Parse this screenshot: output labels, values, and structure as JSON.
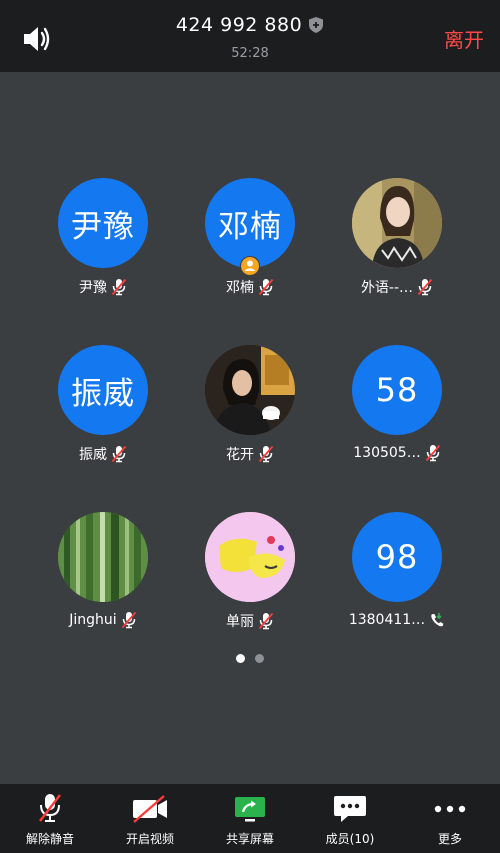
{
  "header": {
    "meeting_id": "424 992 880",
    "timer": "52:28",
    "leave_label": "离开"
  },
  "participants": [
    {
      "name": "尹豫",
      "avatar_text": "尹豫",
      "avatar_type": "text",
      "status": "muted"
    },
    {
      "name": "邓楠",
      "avatar_text": "邓楠",
      "avatar_type": "text",
      "status": "muted",
      "host": true
    },
    {
      "name": "外语--…",
      "avatar_type": "photo",
      "status": "muted"
    },
    {
      "name": "振威",
      "avatar_text": "振威",
      "avatar_type": "text",
      "status": "muted"
    },
    {
      "name": "花开",
      "avatar_type": "photo",
      "status": "muted"
    },
    {
      "name": "130505…",
      "avatar_text": "58",
      "avatar_type": "text",
      "status": "muted"
    },
    {
      "name": "Jinghui",
      "avatar_type": "photo",
      "status": "muted"
    },
    {
      "name": "单丽",
      "avatar_type": "photo",
      "status": "muted"
    },
    {
      "name": "1380411…",
      "avatar_text": "98",
      "avatar_type": "text",
      "status": "phone"
    }
  ],
  "pager": {
    "pages": 2,
    "current": 1
  },
  "toolbar": {
    "unmute_label": "解除静音",
    "video_label": "开启视频",
    "share_label": "共享屏幕",
    "members_label": "成员(10)",
    "more_label": "更多"
  },
  "colors": {
    "accent_blue": "#1478f0",
    "leave_red": "#ff4a4a",
    "share_green": "#2bb24c",
    "host_badge": "#f5a623",
    "background": "#3b3e41",
    "bar": "#1c1d1f"
  },
  "icons": {
    "speaker": "speaker-icon",
    "shield": "shield-icon",
    "muted_mic": "mic-muted-icon",
    "phone": "phone-icon",
    "host": "host-badge-icon"
  }
}
